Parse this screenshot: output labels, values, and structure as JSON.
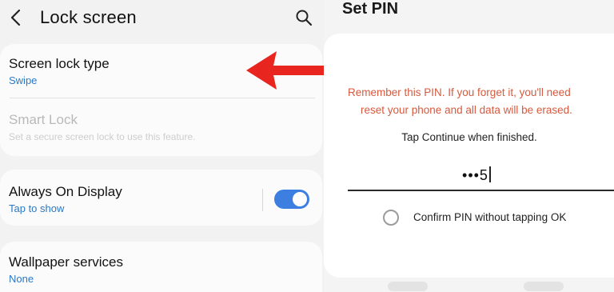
{
  "left": {
    "header": {
      "title": "Lock screen"
    },
    "rows": {
      "screen_lock_type": {
        "title": "Screen lock type",
        "value": "Swipe"
      },
      "smart_lock": {
        "title": "Smart Lock",
        "subtitle": "Set a secure screen lock to use this feature."
      },
      "always_on_display": {
        "title": "Always On Display",
        "value": "Tap to show",
        "toggle_on": true
      },
      "wallpaper_services": {
        "title": "Wallpaper services",
        "value": "None"
      }
    },
    "annotation_color": "#e8261f"
  },
  "right": {
    "title": "Set PIN",
    "warning_line1": "Remember this PIN. If you forget it, you'll need",
    "warning_line2": "reset your phone and all data will be erased.",
    "hint": "Tap Continue when finished.",
    "pin_display": "•••5",
    "confirm_option": "Confirm PIN without tapping OK",
    "confirm_checked": false
  },
  "colors": {
    "accent": "#3d7fe0",
    "link": "#2a79c6",
    "warning": "#d65a3e"
  }
}
